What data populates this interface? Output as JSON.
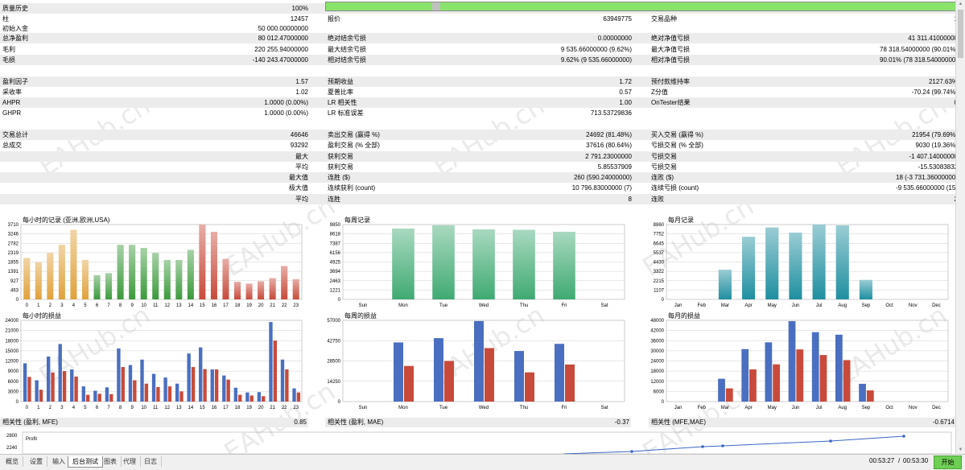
{
  "rows": [
    {
      "cells": [
        [
          "质量历史",
          ""
        ],
        [
          "",
          "100%"
        ]
      ]
    },
    {
      "cells": [
        [
          "柱",
          "12457"
        ],
        [
          "报价",
          "63949775"
        ],
        [
          "交易品种",
          "1"
        ]
      ]
    },
    {
      "cells": [
        [
          "初始入金",
          "50 000.00000000"
        ]
      ]
    },
    {
      "cells": [
        [
          "总净盈利",
          "80 012.47000000"
        ],
        [
          "绝对结余亏损",
          "0.00000000"
        ],
        [
          "绝对净值亏损",
          "41 311.41000000"
        ]
      ]
    },
    {
      "cells": [
        [
          "毛利",
          "220 255.94000000"
        ],
        [
          "最大结余亏损",
          "9 535.66000000 (9.62%)"
        ],
        [
          "最大净值亏损",
          "78 318.54000000 (90.01%)"
        ]
      ]
    },
    {
      "cells": [
        [
          "毛损",
          "-140 243.47000000"
        ],
        [
          "相对结余亏损",
          "9.62% (9 535.66000000)"
        ],
        [
          "相对净值亏损",
          "90.01% (78 318.54000000)"
        ]
      ]
    },
    {
      "cells": []
    },
    {
      "cells": [
        [
          "盈利因子",
          "1.57"
        ],
        [
          "预期收益",
          "1.72"
        ],
        [
          "预付款维持率",
          "2127.63%"
        ]
      ]
    },
    {
      "cells": [
        [
          "采收率",
          "1.02"
        ],
        [
          "夏普比率",
          "0.57"
        ],
        [
          "Z分值",
          "-70.24 (99.74%)"
        ]
      ]
    },
    {
      "cells": [
        [
          "AHPR",
          "1.0000 (0.00%)"
        ],
        [
          "LR 相关性",
          "1.00"
        ],
        [
          "OnTester结果",
          "0"
        ]
      ]
    },
    {
      "cells": [
        [
          "GHPR",
          "1.0000 (0.00%)"
        ],
        [
          "LR 标准误差",
          "713.53729836"
        ]
      ]
    },
    {
      "cells": []
    },
    {
      "cells": [
        [
          "交易总计",
          "46646"
        ],
        [
          "卖出交易 (赢得 %)",
          "24692 (81.48%)"
        ],
        [
          "买入交易 (赢得 %)",
          "21954 (79.69%)"
        ]
      ]
    },
    {
      "cells": [
        [
          "总成交",
          "93292"
        ],
        [
          "盈利交易 (% 全部)",
          "37616 (80.64%)"
        ],
        [
          "亏损交易 (% 全部)",
          "9030 (19.36%)"
        ]
      ]
    },
    {
      "cells": [
        [
          "",
          "最大"
        ],
        [
          "获利交易",
          "2 791.23000000"
        ],
        [
          "亏损交易",
          "-1 407.14000000"
        ]
      ]
    },
    {
      "cells": [
        [
          "",
          "平均"
        ],
        [
          "获利交易",
          "5.85537909"
        ],
        [
          "亏损交易",
          "-15.53083832"
        ]
      ]
    },
    {
      "cells": [
        [
          "",
          "最大值"
        ],
        [
          "连胜 ($)",
          "260 (590.24000000)"
        ],
        [
          "连败 ($)",
          "18 (-3 731.36000000)"
        ]
      ]
    },
    {
      "cells": [
        [
          "",
          "极大值"
        ],
        [
          "连续获利 (count)",
          "10 796.83000000 (7)"
        ],
        [
          "连续亏损 (count)",
          "-9 535.66000000 (15)"
        ]
      ]
    },
    {
      "cells": [
        [
          "",
          "平均"
        ],
        [
          "连胜",
          "8"
        ],
        [
          "连败",
          "2"
        ]
      ]
    }
  ],
  "colors": {
    "green_bar": "#89e36b",
    "orange": "#e0a13a",
    "green": "#3c9a3c",
    "red": "#c84a3a",
    "blue": "#4a6fc0",
    "teal": "#1f8fa0",
    "weekgreen": "#3faa72",
    "profit_line": "#3a66c4"
  },
  "chart_data": [
    {
      "type": "bar",
      "title": "每小时的记录 (亚洲,欧洲,USA)",
      "categories": [
        "0",
        "1",
        "2",
        "3",
        "4",
        "5",
        "6",
        "7",
        "8",
        "9",
        "10",
        "11",
        "12",
        "13",
        "14",
        "15",
        "16",
        "17",
        "18",
        "19",
        "20",
        "21",
        "22",
        "23"
      ],
      "values": [
        2050,
        1830,
        2300,
        2700,
        3450,
        1950,
        1200,
        1300,
        2700,
        2700,
        2550,
        2300,
        1950,
        1950,
        2450,
        3710,
        3350,
        2000,
        870,
        780,
        900,
        1050,
        1650,
        1000
      ],
      "yticks": [
        "0",
        "463",
        "927",
        "1391",
        "1855",
        "2319",
        "2782",
        "3246",
        "3710"
      ],
      "ylim": [
        0,
        3710
      ]
    },
    {
      "type": "bar",
      "title": "每周记录",
      "categories": [
        "Sun",
        "Mon",
        "Tue",
        "Wed",
        "Thu",
        "Fri",
        "Sat"
      ],
      "values": [
        0,
        9300,
        9750,
        9200,
        9150,
        8900,
        0
      ],
      "yticks": [
        "0",
        "1221",
        "2463",
        "3694",
        "4925",
        "6156",
        "7387",
        "8618",
        "9850"
      ],
      "ylim": [
        0,
        9850
      ]
    },
    {
      "type": "bar",
      "title": "每月记录",
      "categories": [
        "Jan",
        "Feb",
        "Mar",
        "Apr",
        "May",
        "Jun",
        "Jul",
        "Aug",
        "Sep",
        "Oct",
        "Nov",
        "Dec"
      ],
      "values": [
        0,
        0,
        3500,
        7400,
        8500,
        7900,
        8860,
        8750,
        2300,
        0,
        0,
        0
      ],
      "yticks": [
        "0",
        "1107",
        "2215",
        "3322",
        "4430",
        "5537",
        "6645",
        "7752",
        "8860"
      ],
      "ylim": [
        0,
        8860
      ]
    },
    {
      "type": "bar",
      "title": "每小时的损益",
      "categories": [
        "0",
        "1",
        "2",
        "3",
        "4",
        "5",
        "6",
        "7",
        "8",
        "9",
        "10",
        "11",
        "12",
        "13",
        "14",
        "15",
        "16",
        "17",
        "18",
        "19",
        "20",
        "21",
        "22",
        "23"
      ],
      "series": [
        {
          "values": [
            11300,
            6300,
            13300,
            17000,
            9500,
            4500,
            3200,
            4200,
            15700,
            10800,
            12400,
            8200,
            7100,
            5300,
            14200,
            16000,
            9500,
            7700,
            4100,
            2700,
            2800,
            23500,
            12400,
            3900
          ]
        },
        {
          "values": [
            7300,
            3500,
            8600,
            9000,
            7400,
            2000,
            2300,
            2200,
            10200,
            6300,
            5300,
            4300,
            4500,
            3000,
            10200,
            9600,
            9500,
            6500,
            2000,
            1800,
            1600,
            18000,
            9500,
            2700
          ]
        }
      ],
      "yticks": [
        "0",
        "3000",
        "6000",
        "9000",
        "12000",
        "15000",
        "18000",
        "21000",
        "24000"
      ],
      "ylim": [
        0,
        24000
      ]
    },
    {
      "type": "bar",
      "title": "每周的损益",
      "categories": [
        "Sun",
        "Mon",
        "Tue",
        "Wed",
        "Thu",
        "Fri",
        "Sat"
      ],
      "series": [
        {
          "values": [
            0,
            41500,
            44500,
            56500,
            35500,
            40500,
            0
          ]
        },
        {
          "values": [
            0,
            25000,
            28500,
            37500,
            20500,
            26000,
            0
          ]
        }
      ],
      "yticks": [
        "0",
        "14250",
        "28500",
        "42750",
        "57000"
      ],
      "ylim": [
        0,
        57000
      ]
    },
    {
      "type": "bar",
      "title": "每月的损益",
      "categories": [
        "Jan",
        "Feb",
        "Mar",
        "Apr",
        "May",
        "Jun",
        "Jul",
        "Aug",
        "Sep",
        "Oct",
        "Nov",
        "Dec"
      ],
      "series": [
        {
          "values": [
            0,
            0,
            13500,
            31000,
            35000,
            47500,
            41000,
            39500,
            10500,
            0,
            0,
            0
          ]
        },
        {
          "values": [
            0,
            0,
            7800,
            19000,
            22000,
            30800,
            27500,
            24500,
            6600,
            0,
            0,
            0
          ]
        }
      ],
      "yticks": [
        "0",
        "6000",
        "12000",
        "18000",
        "24000",
        "30000",
        "36000",
        "42000",
        "48000"
      ],
      "ylim": [
        0,
        48000
      ]
    }
  ],
  "correlations": [
    {
      "label": "相关性 (盈利, MFE)",
      "value": "0.85"
    },
    {
      "label": "相关性 (盈利, MAE)",
      "value": "-0.37"
    },
    {
      "label": "相关性 (MFE,MAE)",
      "value": "-0.6714"
    }
  ],
  "profit_chart": {
    "title": "Profit",
    "yticks": [
      "2800",
      "2240"
    ]
  },
  "tabs": [
    "概览",
    "设置",
    "输入",
    "后台测试",
    "图表",
    "代理",
    "日志"
  ],
  "active_tab": "后台测试",
  "time_elapsed": "00:53:27",
  "time_total": "00:53:30",
  "start_label": "开始",
  "watermark": "EAHub.cn"
}
